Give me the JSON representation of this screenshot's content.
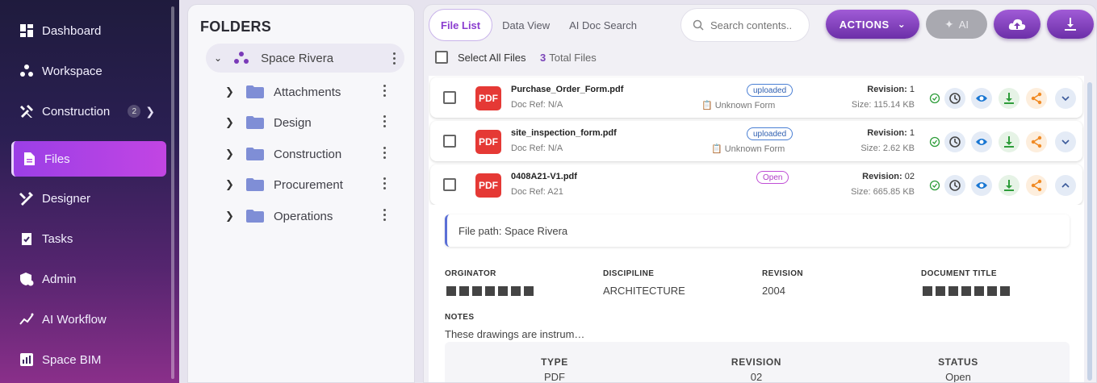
{
  "sidebar": {
    "items": [
      {
        "label": "Dashboard",
        "icon": "dashboard-icon"
      },
      {
        "label": "Workspace",
        "icon": "workspace-icon"
      },
      {
        "label": "Construction",
        "icon": "tools-icon",
        "badge": "2"
      },
      {
        "label": "Files",
        "icon": "file-icon",
        "active": true
      },
      {
        "label": "Designer",
        "icon": "designer-icon"
      },
      {
        "label": "Tasks",
        "icon": "tasks-icon"
      },
      {
        "label": "Admin",
        "icon": "admin-icon"
      },
      {
        "label": "AI Workflow",
        "icon": "ai-workflow-icon"
      },
      {
        "label": "Space BIM",
        "icon": "bim-icon"
      }
    ]
  },
  "folders": {
    "title": "FOLDERS",
    "root": "Space Rivera",
    "items": [
      "Attachments",
      "Design",
      "Construction",
      "Procurement",
      "Operations"
    ]
  },
  "toolbar": {
    "tabs": [
      "File List",
      "Data View",
      "AI Doc Search"
    ],
    "search_placeholder": "Search contents..",
    "actions_label": "ACTIONS",
    "ai_label": "AI"
  },
  "list": {
    "select_all": "Select All Files",
    "total_count": "3",
    "total_label": "Total Files",
    "files": [
      {
        "name": "Purchase_Order_Form.pdf",
        "doc_ref": "Doc Ref: N/A",
        "status": "uploaded",
        "form": "Unknown Form",
        "revision_label": "Revision:",
        "revision": "1",
        "size": "Size: 115.14 KB"
      },
      {
        "name": "site_inspection_form.pdf",
        "doc_ref": "Doc Ref: N/A",
        "status": "uploaded",
        "form": "Unknown Form",
        "revision_label": "Revision:",
        "revision": "1",
        "size": "Size: 2.62 KB"
      },
      {
        "name": "0408A21-V1.pdf",
        "doc_ref": "Doc Ref: A21",
        "status": "Open",
        "form": "",
        "revision_label": "Revision:",
        "revision": "02",
        "size": "Size: 665.85 KB"
      }
    ]
  },
  "details": {
    "file_path": "File path: Space Rivera",
    "originator_label": "ORGINATOR",
    "discipline_label": "DISCIPILINE",
    "discipline_value": "ARCHITECTURE",
    "revision_label": "REVISION",
    "revision_value": "2004",
    "doc_title_label": "DOCUMENT TITLE",
    "notes_label": "NOTES",
    "notes_value": "These drawings are instrum…",
    "table_headers": [
      "TYPE",
      "REVISION",
      "STATUS"
    ],
    "table_values": [
      "PDF",
      "02",
      "Open"
    ]
  },
  "colors": {
    "accent": "#8a3ccf",
    "pdf_red": "#e53935",
    "view_blue": "#1976d2",
    "download_green": "#2e9d3a",
    "share_orange": "#f08a24"
  }
}
